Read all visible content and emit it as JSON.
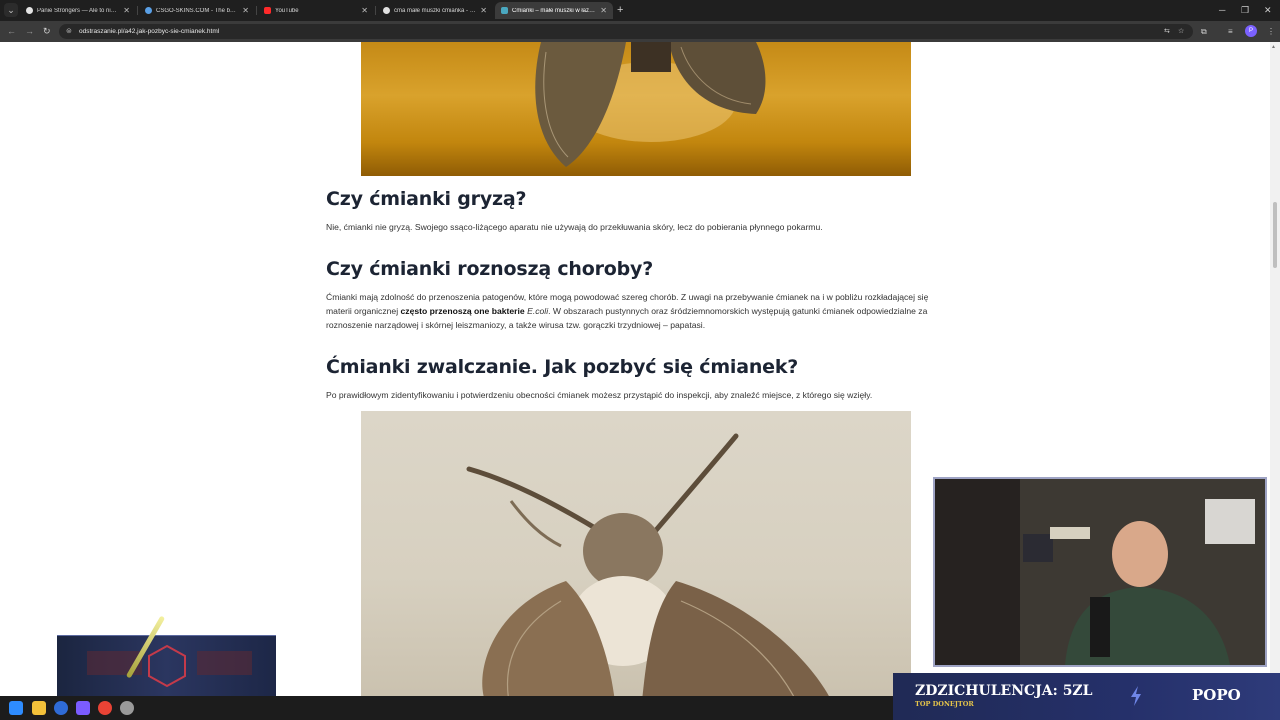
{
  "browser": {
    "tabs": [
      {
        "title": "Panie Strongers — Ale to nie tu",
        "favicon": "tiktok-icon",
        "color": "#e4e4e4",
        "active": false
      },
      {
        "title": "CSGO-SKINS.COM - The best C",
        "favicon": "globe-icon",
        "color": "#5aa0e6",
        "active": false
      },
      {
        "title": "YouTube",
        "favicon": "youtube-icon",
        "color": "#ff2a2a",
        "active": false
      },
      {
        "title": "ćma małe muszki ćmianka - Sz",
        "favicon": "google-icon",
        "color": "#e0e0e0",
        "active": false
      },
      {
        "title": "Ćmianki – małe muszki w łazien",
        "favicon": "site-icon",
        "color": "#4aa8c0",
        "active": true
      }
    ],
    "new_tab": "+",
    "url": "odstraszanie.pl/a42,jak-pozbyc-sie-cmianek.html"
  },
  "article": {
    "sections": [
      {
        "heading": "Czy ćmianki gryzą?",
        "text": "Nie, ćmianki nie gryzą. Swojego ssąco-liżącego aparatu nie używają do przekłuwania skóry, lecz do pobierania płynnego pokarmu."
      },
      {
        "heading": "Czy ćmianki roznoszą choroby?",
        "text_before": "Ćmianki mają zdolność do przenoszenia patogenów, które mogą powodować szereg chorób. Z uwagi na przebywanie ćmianek na i w pobliżu rozkładającej się materii organicznej ",
        "text_bold": "często przenoszą one bakterie",
        "text_italic": "E.coli",
        "text_after": ". W obszarach pustynnych oraz śródziemnomorskich występują gatunki ćmianek odpowiedzialne za roznoszenie narządowej i skórnej leiszmaniozy, a także wirusa tzw. gorączki trzydniowej – papatasi."
      },
      {
        "heading": "Ćmianki zwalczanie. Jak pozbyć się ćmianek?",
        "text": "Po prawidłowym zidentyfikowaniu i potwierdzeniu obecności ćmianek możesz przystąpić do inspekcji, aby znaleźć miejsce, z którego się wzięły."
      }
    ]
  },
  "overlay": {
    "donation_text": "ZDZICHULENCJA: 5ZL",
    "donation_sub": "TOP DONEJTOR",
    "donor_name": "POPO"
  },
  "colors": {
    "accent": "#4aa8c0",
    "donation_banner": "#25306a",
    "donation_gold": "#e6c54a"
  }
}
